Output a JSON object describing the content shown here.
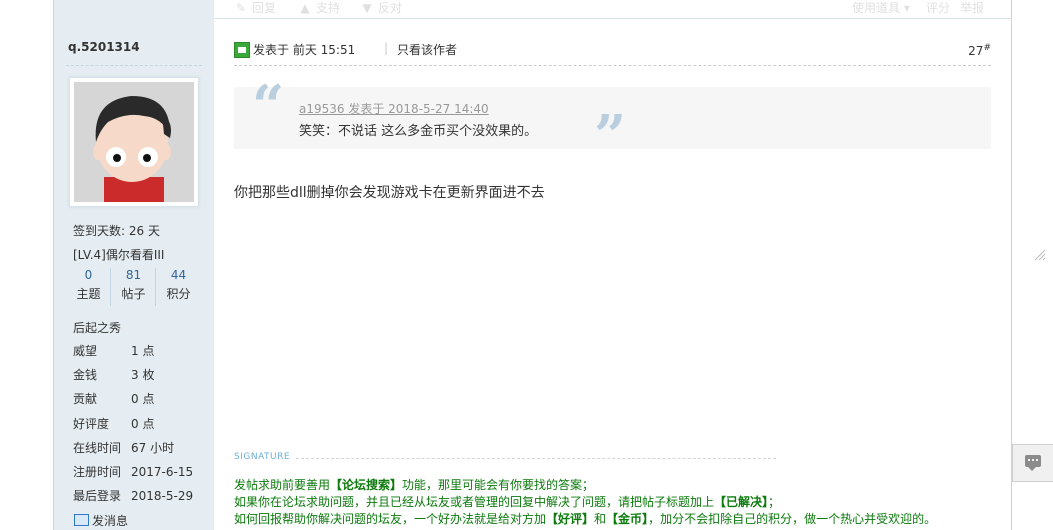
{
  "prev_bar": {
    "reply": "回复",
    "support": "支持",
    "oppose": "反对",
    "use_tool": "使用道具",
    "rate": "评分",
    "report": "举报"
  },
  "user": {
    "name": "q.5201314",
    "checkin": "签到天数: 26 天",
    "level": "[LV.4]偶尔看看III",
    "stats": [
      {
        "num": "0",
        "label": "主题"
      },
      {
        "num": "81",
        "label": "帖子"
      },
      {
        "num": "44",
        "label": "积分"
      }
    ],
    "rank": "后起之秀",
    "details": [
      {
        "k": "威望",
        "v": "1 点"
      },
      {
        "k": "金钱",
        "v": "3 枚"
      },
      {
        "k": "贡献",
        "v": "0 点"
      },
      {
        "k": "好评度",
        "v": "0 点"
      },
      {
        "k": "在线时间",
        "v": "67 小时"
      },
      {
        "k": "注册时间",
        "v": "2017-6-15"
      },
      {
        "k": "最后登录",
        "v": "2018-5-29"
      }
    ],
    "message": "发消息"
  },
  "post": {
    "posted": "发表于 前天 15:51",
    "separator": "|",
    "only_author": "只看该作者",
    "floor": "27",
    "floor_mark": "#",
    "quote": {
      "header": "a19536 发表于 2018-5-27 14:40",
      "text": "笑笑：不说话  这么多金币买个没效果的。"
    },
    "body": "你把那些dll删掉你会发现游戏卡在更新界面进不去"
  },
  "signature": {
    "label": "SIGNATURE",
    "line1_pre": "发帖求助前要善用",
    "line1_b": "【论坛搜索】",
    "line1_post": "功能，那里可能会有你要找的答案；",
    "line2_pre": "如果你在论坛求助问题，并且已经从坛友或者管理的回复中解决了问题，请把帖子标题加上",
    "line2_b": "【已解决】",
    "line2_post": "；",
    "line3_pre": "如何回报帮助你解决问题的坛友，一个好办法就是给对方加",
    "line3_b1": "【好评】",
    "line3_mid": "和",
    "line3_b2": "【金币】",
    "line3_post": "，加分不会扣除自己的积分，做一个热心并受欢迎的。"
  },
  "colors": {
    "sidebar_bg": "#e5edf2",
    "border": "#c2d5e3",
    "signature_green": "#0c7a0c",
    "link_blue": "#336699"
  }
}
